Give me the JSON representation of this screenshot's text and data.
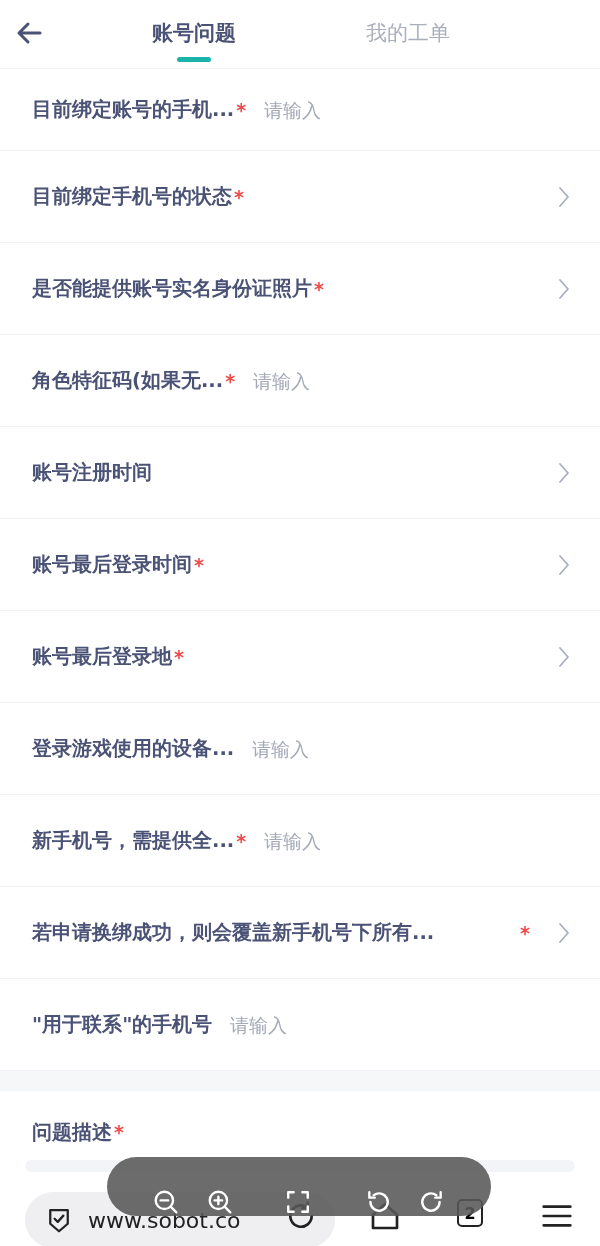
{
  "tabs": [
    {
      "label": "账号问题",
      "selected": true
    },
    {
      "label": "我的工单",
      "selected": false
    }
  ],
  "fields": [
    {
      "label": "目前绑定账号的手机...",
      "mark": "*",
      "kind": "input",
      "placeholder": "请输入"
    },
    {
      "label": "目前绑定手机号的状态",
      "mark": "*",
      "kind": "select"
    },
    {
      "label": "是否能提供账号实名身份证照片",
      "mark": "*",
      "kind": "select"
    },
    {
      "label": "角色特征码(如果无...",
      "mark": "*",
      "kind": "input",
      "placeholder": "请输入"
    },
    {
      "label": "账号注册时间",
      "kind": "select"
    },
    {
      "label": "账号最后登录时间",
      "mark": "*",
      "kind": "select"
    },
    {
      "label": "账号最后登录地",
      "mark": "*",
      "kind": "select"
    },
    {
      "label": "登录游戏使用的设备...",
      "kind": "input",
      "placeholder": "请输入"
    },
    {
      "label": "新手机号，需提供全...",
      "mark": "*",
      "kind": "input",
      "placeholder": "请输入"
    },
    {
      "label": "若申请换绑成功，则会覆盖新手机号下所有...",
      "mark": "*",
      "kind": "select"
    },
    {
      "label": "\"用于联系\"的手机号",
      "kind": "input",
      "placeholder": "请输入"
    }
  ],
  "description": {
    "label": "问题描述",
    "mark": "*"
  },
  "browser": {
    "url": "www.sobot.co",
    "tab_count": "2"
  }
}
